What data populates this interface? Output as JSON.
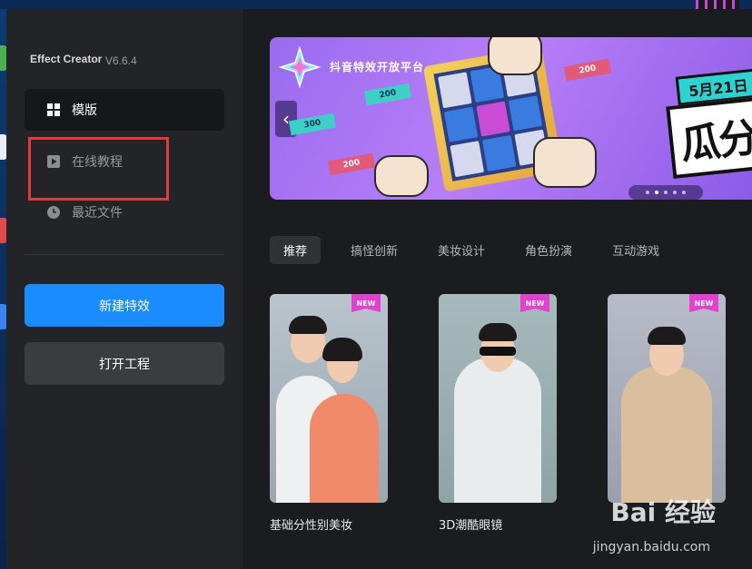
{
  "app": {
    "title": "Effect Creator",
    "version": "V6.6.4"
  },
  "sidebar": {
    "items": [
      {
        "label": "模版",
        "icon": "grid-icon",
        "active": true
      },
      {
        "label": "在线教程",
        "icon": "play-icon",
        "active": false
      },
      {
        "label": "最近文件",
        "icon": "clock-icon",
        "active": false
      }
    ],
    "new_button": "新建特效",
    "open_button": "打开工程"
  },
  "banner": {
    "title": "抖音特效开放平台",
    "date": "5月21日",
    "headline": "瓜分",
    "bill_values": [
      "200",
      "300",
      "200",
      "200"
    ],
    "dot_count": 5,
    "active_dot": 1,
    "colors": {
      "bg": "#9a6bf0",
      "badge": "#2bd4d0"
    }
  },
  "tabs": [
    "推荐",
    "搞怪创新",
    "美妆设计",
    "角色扮演",
    "互动游戏"
  ],
  "active_tab": 0,
  "cards": [
    {
      "title": "基础分性别美妆",
      "badge": "NEW"
    },
    {
      "title": "3D潮酷眼镜",
      "badge": "NEW"
    },
    {
      "title": "",
      "badge": "NEW"
    }
  ],
  "watermark": {
    "text": "Bai 经验",
    "url": "jingyan.baidu.com"
  },
  "colors": {
    "accent": "#1a8cff",
    "highlight_box": "#e03a3a",
    "new_badge": "#e33fd0"
  }
}
